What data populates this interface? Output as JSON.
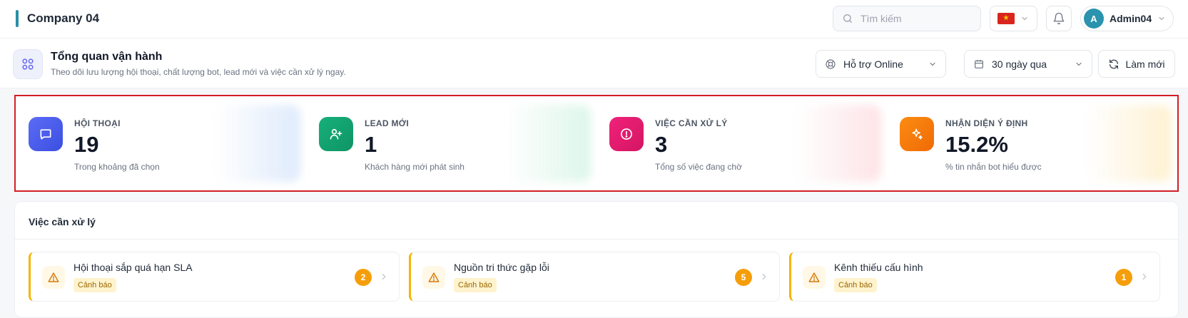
{
  "header": {
    "company": "Company 04",
    "search_placeholder": "Tìm kiếm",
    "language_flag": "VN",
    "user": {
      "initial": "A",
      "name": "Admin04"
    }
  },
  "page": {
    "title": "Tổng quan vận hành",
    "subtitle": "Theo dõi lưu lượng hội thoại, chất lượng bot, lead mới và việc cần xử lý ngay.",
    "support_select": "Hỗ trợ Online",
    "range_select": "30 ngày qua",
    "refresh_label": "Làm mới"
  },
  "kpis": [
    {
      "label": "HỘI THOẠI",
      "value": "19",
      "hint": "Trong khoảng đã chọn",
      "icon": "chat-icon",
      "color_from": "#5b6cf6",
      "color_to": "#3b4fe0",
      "glow": "#dbe8fb"
    },
    {
      "label": "LEAD MỚI",
      "value": "1",
      "hint": "Khách hàng mới phát sinh",
      "icon": "user-plus-icon",
      "color_from": "#16b07a",
      "color_to": "#0f9466",
      "glow": "#d9f5e7"
    },
    {
      "label": "VIỆC CẦN XỬ LÝ",
      "value": "3",
      "hint": "Tổng số việc đang chờ",
      "icon": "alert-circle-icon",
      "color_from": "#f0227a",
      "color_to": "#d41563",
      "glow": "#fde0e3"
    },
    {
      "label": "NHẬN DIỆN Ý ĐỊNH",
      "value": "15.2%",
      "hint": "% tin nhắn bot hiểu được",
      "icon": "sparkles-icon",
      "color_from": "#fb8c12",
      "color_to": "#f06a05",
      "glow": "#fdf0cc"
    }
  ],
  "tasks": {
    "title": "Việc cần xử lý",
    "items": [
      {
        "title": "Hội thoại sắp quá hạn SLA",
        "badge": "Cảnh báo",
        "count": "2"
      },
      {
        "title": "Nguồn tri thức gặp lỗi",
        "badge": "Cảnh báo",
        "count": "5"
      },
      {
        "title": "Kênh thiếu cấu hình",
        "badge": "Cảnh báo",
        "count": "1"
      }
    ]
  },
  "colors": {
    "accent": "#2a8fa8",
    "highlight_border": "#d11f26",
    "warning": "#f59e0b"
  }
}
